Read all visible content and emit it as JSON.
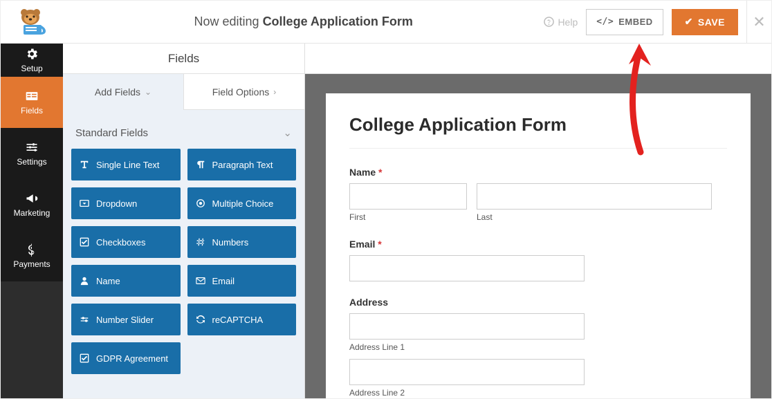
{
  "topbar": {
    "editing_prefix": "Now editing ",
    "form_name": "College Application Form",
    "help": "Help",
    "embed": "EMBED",
    "save": "SAVE"
  },
  "sidenav": {
    "setup": "Setup",
    "fields": "Fields",
    "settings": "Settings",
    "marketing": "Marketing",
    "payments": "Payments"
  },
  "left": {
    "header": "Fields",
    "tab_add": "Add Fields",
    "tab_options": "Field Options",
    "section_standard": "Standard Fields",
    "buttons": {
      "single_line": "Single Line Text",
      "paragraph": "Paragraph Text",
      "dropdown": "Dropdown",
      "multiple_choice": "Multiple Choice",
      "checkboxes": "Checkboxes",
      "numbers": "Numbers",
      "name": "Name",
      "email": "Email",
      "number_slider": "Number Slider",
      "recaptcha": "reCAPTCHA",
      "gdpr": "GDPR Agreement"
    }
  },
  "preview": {
    "form_title": "College Application Form",
    "name_label": "Name",
    "first": "First",
    "last": "Last",
    "email_label": "Email",
    "address_label": "Address",
    "addr1": "Address Line 1",
    "addr2": "Address Line 2"
  }
}
